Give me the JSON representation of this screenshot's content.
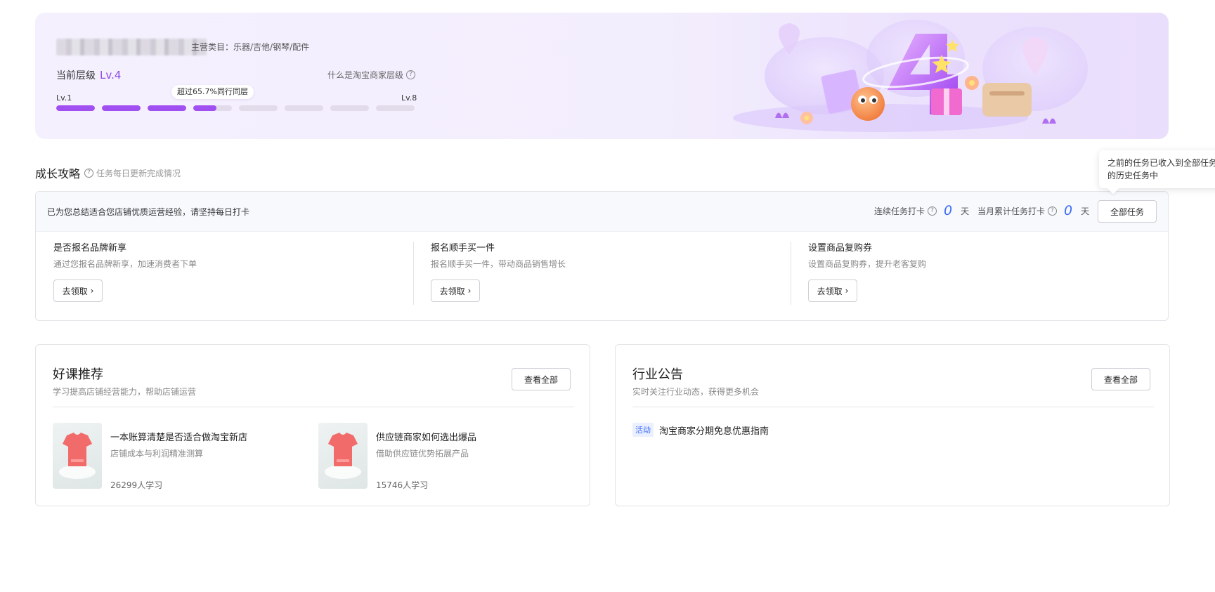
{
  "hero": {
    "category": "主营类目：乐器/吉他/钢琴/配件",
    "current_level_label": "当前层级",
    "current_level": "Lv.4",
    "what_is_level": "什么是淘宝商家层级",
    "progress_tip": "超过65.7%同行同层",
    "min_level": "Lv.1",
    "max_level": "Lv.8",
    "segments_progress": [
      1,
      1,
      1,
      0.6,
      0,
      0,
      0,
      0
    ],
    "accent_color": "#a04ff0"
  },
  "growth": {
    "title": "成长攻略",
    "subtitle": "任务每日更新完成情况",
    "tip": "已为您总结适合您店铺优质运营经验，请坚持每日打卡",
    "streak_label": "连续任务打卡",
    "streak_value": "0",
    "monthly_label": "当月累计任务打卡",
    "monthly_value": "0",
    "day_unit": "天",
    "all_tasks_button": "全部任务",
    "tasks": [
      {
        "title": "是否报名品牌新享",
        "desc": "通过您报名品牌新享，加速消费者下单",
        "action": "去领取"
      },
      {
        "title": "报名顺手买一件",
        "desc": "报名顺手买一件，带动商品销售增长",
        "action": "去领取"
      },
      {
        "title": "设置商品复购券",
        "desc": "设置商品复购券，提升老客复购",
        "action": "去领取"
      }
    ]
  },
  "tooltip": {
    "line1": "之前的任务已收入到全部任务",
    "line2": "的历史任务中"
  },
  "courses_panel": {
    "title": "好课推荐",
    "subtitle": "学习提高店铺经营能力，帮助店铺运营",
    "view_all": "查看全部",
    "items": [
      {
        "title": "一本账算清楚是否适合做淘宝新店",
        "desc": "店铺成本与利润精准测算",
        "learners": "26299人学习"
      },
      {
        "title": "供应链商家如何选出爆品",
        "desc": "借助供应链优势拓展产品",
        "learners": "15746人学习"
      }
    ]
  },
  "notice_panel": {
    "title": "行业公告",
    "subtitle": "实时关注行业动态，获得更多机会",
    "view_all": "查看全部",
    "items": [
      {
        "tag": "活动",
        "text": "淘宝商家分期免息优惠指南"
      }
    ]
  }
}
